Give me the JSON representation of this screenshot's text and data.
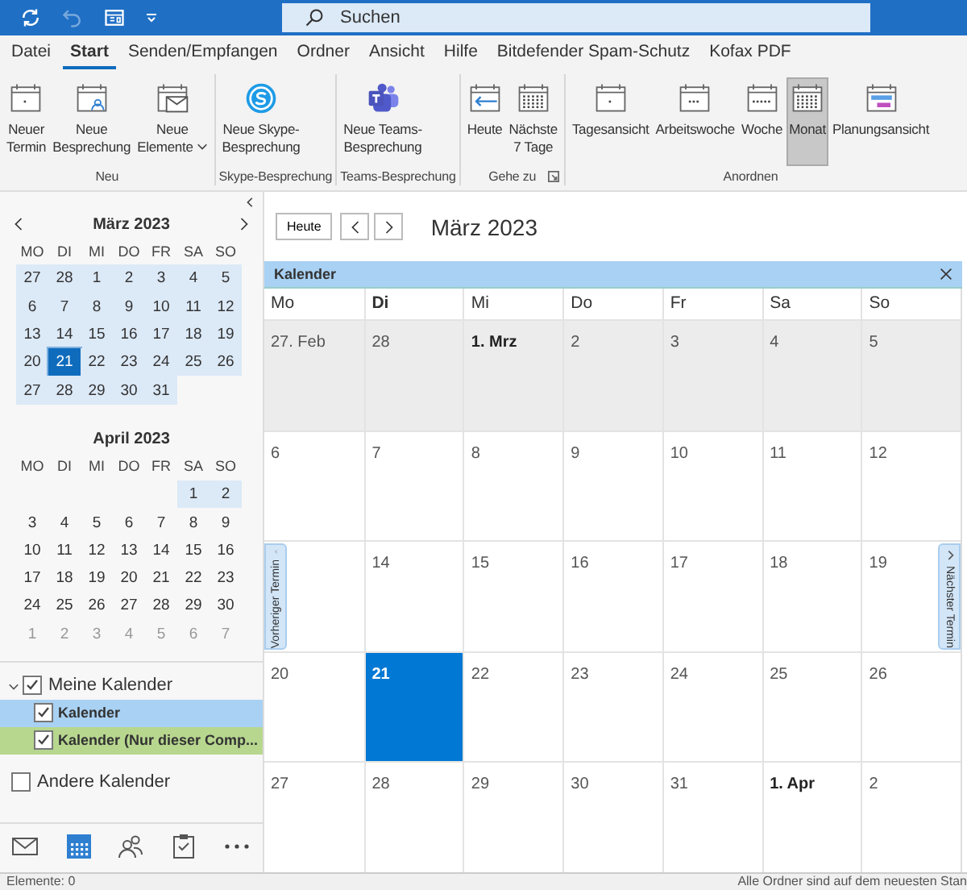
{
  "title_bar": {
    "search": {
      "placeholder": "Suchen"
    },
    "undo_disabled": true
  },
  "menu_tabs": [
    {
      "label": "Datei",
      "selected": false
    },
    {
      "label": "Start",
      "selected": true
    },
    {
      "label": "Senden/Empfangen",
      "selected": false
    },
    {
      "label": "Ordner",
      "selected": false
    },
    {
      "label": "Ansicht",
      "selected": false
    },
    {
      "label": "Hilfe",
      "selected": false
    },
    {
      "label": "Bitdefender Spam-Schutz",
      "selected": false
    },
    {
      "label": "Kofax PDF",
      "selected": false
    }
  ],
  "ribbon": {
    "groups": [
      {
        "label": "Neu",
        "launcher": false,
        "buttons": [
          {
            "lines": [
              "Neuer",
              "Termin"
            ],
            "dropdown": false,
            "selected": false
          },
          {
            "lines": [
              "Neue",
              "Besprechung"
            ],
            "dropdown": false,
            "selected": false
          },
          {
            "lines": [
              "Neue",
              "Elemente"
            ],
            "dropdown": true,
            "selected": false
          }
        ]
      },
      {
        "label": "Skype-Besprechung",
        "launcher": false,
        "buttons": [
          {
            "lines": [
              "Neue Skype-",
              "Besprechung"
            ],
            "dropdown": false,
            "selected": false
          }
        ]
      },
      {
        "label": "Teams-Besprechung",
        "launcher": false,
        "buttons": [
          {
            "lines": [
              "Neue Teams-",
              "Besprechung"
            ],
            "dropdown": false,
            "selected": false
          }
        ]
      },
      {
        "label": "Gehe zu",
        "launcher": true,
        "buttons": [
          {
            "lines": [
              "Heute"
            ],
            "dropdown": false,
            "selected": false
          },
          {
            "lines": [
              "Nächste",
              "7 Tage"
            ],
            "dropdown": false,
            "selected": false
          }
        ]
      },
      {
        "label": "Anordnen",
        "launcher": false,
        "buttons": [
          {
            "lines": [
              "Tagesansicht"
            ],
            "dropdown": false,
            "selected": false
          },
          {
            "lines": [
              "Arbeitswoche"
            ],
            "dropdown": false,
            "selected": false
          },
          {
            "lines": [
              "Woche"
            ],
            "dropdown": false,
            "selected": false
          },
          {
            "lines": [
              "Monat"
            ],
            "dropdown": false,
            "selected": true
          },
          {
            "lines": [
              "Planungsansicht"
            ],
            "dropdown": false,
            "selected": false
          }
        ]
      }
    ]
  },
  "navigator": [
    {
      "title": "März 2023",
      "weekdays": [
        "MO",
        "DI",
        "MI",
        "DO",
        "FR",
        "SA",
        "SO"
      ],
      "weeks": [
        [
          {
            "label": "27",
            "in_range": true,
            "selected": false,
            "muted": false
          },
          {
            "label": "28",
            "in_range": true,
            "selected": false,
            "muted": false
          },
          {
            "label": "1",
            "in_range": true,
            "selected": false,
            "muted": false
          },
          {
            "label": "2",
            "in_range": true,
            "selected": false,
            "muted": false
          },
          {
            "label": "3",
            "in_range": true,
            "selected": false,
            "muted": false
          },
          {
            "label": "4",
            "in_range": true,
            "selected": false,
            "muted": false
          },
          {
            "label": "5",
            "in_range": true,
            "selected": false,
            "muted": false
          }
        ],
        [
          {
            "label": "6",
            "in_range": true,
            "selected": false,
            "muted": false
          },
          {
            "label": "7",
            "in_range": true,
            "selected": false,
            "muted": false
          },
          {
            "label": "8",
            "in_range": true,
            "selected": false,
            "muted": false
          },
          {
            "label": "9",
            "in_range": true,
            "selected": false,
            "muted": false
          },
          {
            "label": "10",
            "in_range": true,
            "selected": false,
            "muted": false
          },
          {
            "label": "11",
            "in_range": true,
            "selected": false,
            "muted": false
          },
          {
            "label": "12",
            "in_range": true,
            "selected": false,
            "muted": false
          }
        ],
        [
          {
            "label": "13",
            "in_range": true,
            "selected": false,
            "muted": false
          },
          {
            "label": "14",
            "in_range": true,
            "selected": false,
            "muted": false
          },
          {
            "label": "15",
            "in_range": true,
            "selected": false,
            "muted": false
          },
          {
            "label": "16",
            "in_range": true,
            "selected": false,
            "muted": false
          },
          {
            "label": "17",
            "in_range": true,
            "selected": false,
            "muted": false
          },
          {
            "label": "18",
            "in_range": true,
            "selected": false,
            "muted": false
          },
          {
            "label": "19",
            "in_range": true,
            "selected": false,
            "muted": false
          }
        ],
        [
          {
            "label": "20",
            "in_range": true,
            "selected": false,
            "muted": false
          },
          {
            "label": "21",
            "in_range": true,
            "selected": true,
            "muted": false
          },
          {
            "label": "22",
            "in_range": true,
            "selected": false,
            "muted": false
          },
          {
            "label": "23",
            "in_range": true,
            "selected": false,
            "muted": false
          },
          {
            "label": "24",
            "in_range": true,
            "selected": false,
            "muted": false
          },
          {
            "label": "25",
            "in_range": true,
            "selected": false,
            "muted": false
          },
          {
            "label": "26",
            "in_range": true,
            "selected": false,
            "muted": false
          }
        ],
        [
          {
            "label": "27",
            "in_range": true,
            "selected": false,
            "muted": false
          },
          {
            "label": "28",
            "in_range": true,
            "selected": false,
            "muted": false
          },
          {
            "label": "29",
            "in_range": true,
            "selected": false,
            "muted": false
          },
          {
            "label": "30",
            "in_range": true,
            "selected": false,
            "muted": false
          },
          {
            "label": "31",
            "in_range": true,
            "selected": false,
            "muted": false
          }
        ]
      ]
    },
    {
      "title": "April 2023",
      "weekdays": [
        "MO",
        "DI",
        "MI",
        "DO",
        "FR",
        "SA",
        "SO"
      ],
      "weeks": [
        [
          {
            "label": "1",
            "in_range": true,
            "selected": false,
            "muted": false
          },
          {
            "label": "2",
            "in_range": true,
            "selected": false,
            "muted": false
          }
        ],
        [
          {
            "label": "3",
            "in_range": false,
            "selected": false,
            "muted": false
          },
          {
            "label": "4",
            "in_range": false,
            "selected": false,
            "muted": false
          },
          {
            "label": "5",
            "in_range": false,
            "selected": false,
            "muted": false
          },
          {
            "label": "6",
            "in_range": false,
            "selected": false,
            "muted": false
          },
          {
            "label": "7",
            "in_range": false,
            "selected": false,
            "muted": false
          },
          {
            "label": "8",
            "in_range": false,
            "selected": false,
            "muted": false
          },
          {
            "label": "9",
            "in_range": false,
            "selected": false,
            "muted": false
          }
        ],
        [
          {
            "label": "10",
            "in_range": false,
            "selected": false,
            "muted": false
          },
          {
            "label": "11",
            "in_range": false,
            "selected": false,
            "muted": false
          },
          {
            "label": "12",
            "in_range": false,
            "selected": false,
            "muted": false
          },
          {
            "label": "13",
            "in_range": false,
            "selected": false,
            "muted": false
          },
          {
            "label": "14",
            "in_range": false,
            "selected": false,
            "muted": false
          },
          {
            "label": "15",
            "in_range": false,
            "selected": false,
            "muted": false
          },
          {
            "label": "16",
            "in_range": false,
            "selected": false,
            "muted": false
          }
        ],
        [
          {
            "label": "17",
            "in_range": false,
            "selected": false,
            "muted": false
          },
          {
            "label": "18",
            "in_range": false,
            "selected": false,
            "muted": false
          },
          {
            "label": "19",
            "in_range": false,
            "selected": false,
            "muted": false
          },
          {
            "label": "20",
            "in_range": false,
            "selected": false,
            "muted": false
          },
          {
            "label": "21",
            "in_range": false,
            "selected": false,
            "muted": false
          },
          {
            "label": "22",
            "in_range": false,
            "selected": false,
            "muted": false
          },
          {
            "label": "23",
            "in_range": false,
            "selected": false,
            "muted": false
          }
        ],
        [
          {
            "label": "24",
            "in_range": false,
            "selected": false,
            "muted": false
          },
          {
            "label": "25",
            "in_range": false,
            "selected": false,
            "muted": false
          },
          {
            "label": "26",
            "in_range": false,
            "selected": false,
            "muted": false
          },
          {
            "label": "27",
            "in_range": false,
            "selected": false,
            "muted": false
          },
          {
            "label": "28",
            "in_range": false,
            "selected": false,
            "muted": false
          },
          {
            "label": "29",
            "in_range": false,
            "selected": false,
            "muted": false
          },
          {
            "label": "30",
            "in_range": false,
            "selected": false,
            "muted": false
          }
        ],
        [
          {
            "label": "1",
            "in_range": false,
            "selected": false,
            "muted": true
          },
          {
            "label": "2",
            "in_range": false,
            "selected": false,
            "muted": true
          },
          {
            "label": "3",
            "in_range": false,
            "selected": false,
            "muted": true
          },
          {
            "label": "4",
            "in_range": false,
            "selected": false,
            "muted": true
          },
          {
            "label": "5",
            "in_range": false,
            "selected": false,
            "muted": true
          },
          {
            "label": "6",
            "in_range": false,
            "selected": false,
            "muted": true
          },
          {
            "label": "7",
            "in_range": false,
            "selected": false,
            "muted": true
          }
        ]
      ]
    }
  ],
  "folders": [
    {
      "label": "Meine Kalender",
      "checked": true,
      "expanded": true,
      "children": [
        {
          "label": "Kalender",
          "checked": true,
          "color": "#a9d1f3"
        },
        {
          "label": "Kalender (Nur dieser Comp...",
          "checked": true,
          "color": "#b7d78f"
        }
      ]
    },
    {
      "label": "Andere Kalender",
      "checked": false
    }
  ],
  "nav_bar": [
    {
      "selected": false
    },
    {
      "selected": true
    },
    {
      "selected": false
    },
    {
      "selected": false
    },
    {
      "selected": false
    }
  ],
  "toolbar": {
    "today_button": "Heute",
    "title": "März 2023"
  },
  "calendar": {
    "name": "Kalender",
    "weekdays": [
      {
        "label": "Mo",
        "current": false
      },
      {
        "label": "Di",
        "current": true
      },
      {
        "label": "Mi",
        "current": false
      },
      {
        "label": "Do",
        "current": false
      },
      {
        "label": "Fr",
        "current": false
      },
      {
        "label": "Sa",
        "current": false
      },
      {
        "label": "So",
        "current": false
      }
    ],
    "weeks": [
      [
        {
          "label": "27. Feb",
          "bold": false,
          "today": false,
          "shaded": true
        },
        {
          "label": "28",
          "bold": false,
          "today": false,
          "shaded": true
        },
        {
          "label": "1. Mrz",
          "bold": true,
          "today": false,
          "shaded": true
        },
        {
          "label": "2",
          "bold": false,
          "today": false,
          "shaded": true
        },
        {
          "label": "3",
          "bold": false,
          "today": false,
          "shaded": true
        },
        {
          "label": "4",
          "bold": false,
          "today": false,
          "shaded": true
        },
        {
          "label": "5",
          "bold": false,
          "today": false,
          "shaded": true
        }
      ],
      [
        {
          "label": "6",
          "bold": false,
          "today": false,
          "shaded": false
        },
        {
          "label": "7",
          "bold": false,
          "today": false,
          "shaded": false
        },
        {
          "label": "8",
          "bold": false,
          "today": false,
          "shaded": false
        },
        {
          "label": "9",
          "bold": false,
          "today": false,
          "shaded": false
        },
        {
          "label": "10",
          "bold": false,
          "today": false,
          "shaded": false
        },
        {
          "label": "11",
          "bold": false,
          "today": false,
          "shaded": false
        },
        {
          "label": "12",
          "bold": false,
          "today": false,
          "shaded": false
        }
      ],
      [
        {
          "today": false,
          "shaded": false
        },
        {
          "label": "14",
          "bold": false,
          "today": false,
          "shaded": false
        },
        {
          "label": "15",
          "bold": false,
          "today": false,
          "shaded": false
        },
        {
          "label": "16",
          "bold": false,
          "today": false,
          "shaded": false
        },
        {
          "label": "17",
          "bold": false,
          "today": false,
          "shaded": false
        },
        {
          "label": "18",
          "bold": false,
          "today": false,
          "shaded": false
        },
        {
          "label": "19",
          "bold": false,
          "today": false,
          "shaded": false
        }
      ],
      [
        {
          "label": "20",
          "bold": false,
          "today": false,
          "shaded": false
        },
        {
          "label": "21",
          "bold": true,
          "today": true,
          "shaded": false
        },
        {
          "label": "22",
          "bold": false,
          "today": false,
          "shaded": false
        },
        {
          "label": "23",
          "bold": false,
          "today": false,
          "shaded": false
        },
        {
          "label": "24",
          "bold": false,
          "today": false,
          "shaded": false
        },
        {
          "label": "25",
          "bold": false,
          "today": false,
          "shaded": false
        },
        {
          "label": "26",
          "bold": false,
          "today": false,
          "shaded": false
        }
      ],
      [
        {
          "label": "27",
          "bold": false,
          "today": false,
          "shaded": false
        },
        {
          "label": "28",
          "bold": false,
          "today": false,
          "shaded": false
        },
        {
          "label": "29",
          "bold": false,
          "today": false,
          "shaded": false
        },
        {
          "label": "30",
          "bold": false,
          "today": false,
          "shaded": false
        },
        {
          "label": "31",
          "bold": false,
          "today": false,
          "shaded": false
        },
        {
          "label": "1. Apr",
          "bold": true,
          "today": false,
          "shaded": false
        },
        {
          "label": "2",
          "bold": false,
          "today": false,
          "shaded": false
        }
      ]
    ]
  },
  "side_tabs": {
    "previous": "Vorheriger Termin",
    "next": "Nächster Termin"
  },
  "status_bar": {
    "left": "Elemente: 0",
    "right": "Alle Ordner sind auf dem neuesten Stan"
  }
}
